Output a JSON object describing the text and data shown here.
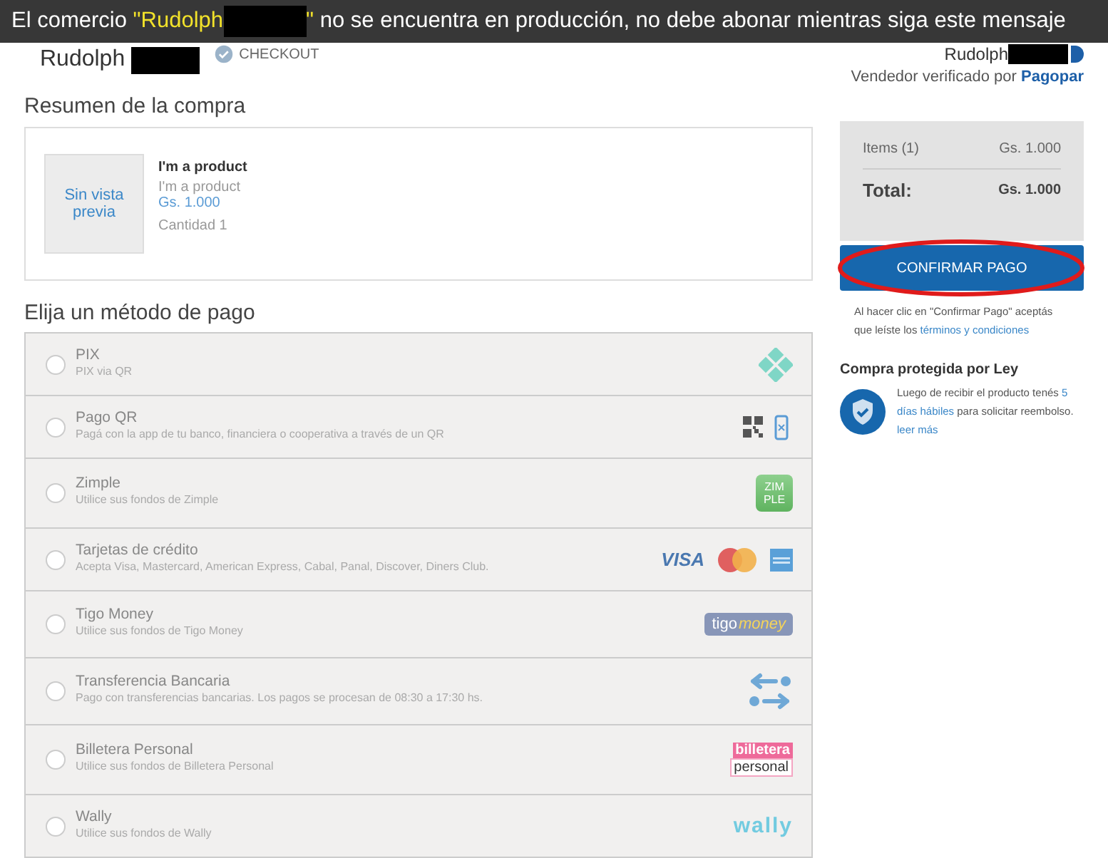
{
  "banner": {
    "before": "El comercio ",
    "merchant": "\"Rudolph",
    "merchant_end": "\"",
    "after": " no se encuentra en producción, no debe abonar mientras siga este mensaje"
  },
  "header": {
    "store": "Rudolph",
    "step": "CHECKOUT",
    "seller": "Rudolph",
    "verified": "Vendedor verificado por",
    "verifier": "Pagopar"
  },
  "summary": {
    "title": "Resumen de la compra",
    "preview": "Sin vista previa",
    "product": {
      "name": "I'm a product",
      "description": "I'm a product",
      "price": "Gs. 1.000",
      "quantity": "Cantidad 1"
    }
  },
  "payment": {
    "title": "Elija un método de pago",
    "methods": [
      {
        "kind": "pix",
        "name": "PIX",
        "description": "PIX via QR",
        "selected": false
      },
      {
        "kind": "qr",
        "name": "Pago QR",
        "description": "Pagá con la app de tu banco, financiera o cooperativa a través de un QR",
        "selected": false
      },
      {
        "kind": "zimple",
        "name": "Zimple",
        "description": "Utilice sus fondos de Zimple",
        "selected": false,
        "logo_text": [
          "ZIM",
          "PLE"
        ]
      },
      {
        "kind": "cards",
        "name": "Tarjetas de crédito",
        "description": "Acepta Visa, Mastercard, American Express, Cabal, Panal, Discover, Diners Club.",
        "selected": false,
        "logo_text": [
          "VISA"
        ]
      },
      {
        "kind": "tigo",
        "name": "Tigo Money",
        "description": "Utilice sus fondos de Tigo Money",
        "selected": false,
        "logo_text": [
          "tigo",
          "money"
        ]
      },
      {
        "kind": "transfer",
        "name": "Transferencia Bancaria",
        "description": "Pago con transferencias bancarias. Los pagos se procesan de 08:30 a 17:30 hs.",
        "selected": false
      },
      {
        "kind": "billetera",
        "name": "Billetera Personal",
        "description": "Utilice sus fondos de Billetera Personal",
        "selected": false,
        "logo_text": [
          "billetera",
          "personal"
        ]
      },
      {
        "kind": "wally",
        "name": "Wally",
        "description": "Utilice sus fondos de Wally",
        "selected": false,
        "logo_text": [
          "wally"
        ]
      }
    ]
  },
  "totals": {
    "items_label": "Items (1)",
    "items_value": "Gs. 1.000",
    "total_label": "Total:",
    "total_value": "Gs. 1.000"
  },
  "confirm_button": "CONFIRMAR PAGO",
  "terms": {
    "text": "Al hacer clic en \"Confirmar Pago\" aceptás que leíste los",
    "link": "términos y condiciones"
  },
  "protection": {
    "title": "Compra protegida por Ley",
    "text": "Luego de recibir el producto tenés",
    "days": "5 días hábiles",
    "text2": "para solicitar reembolso.",
    "link": "leer más"
  }
}
